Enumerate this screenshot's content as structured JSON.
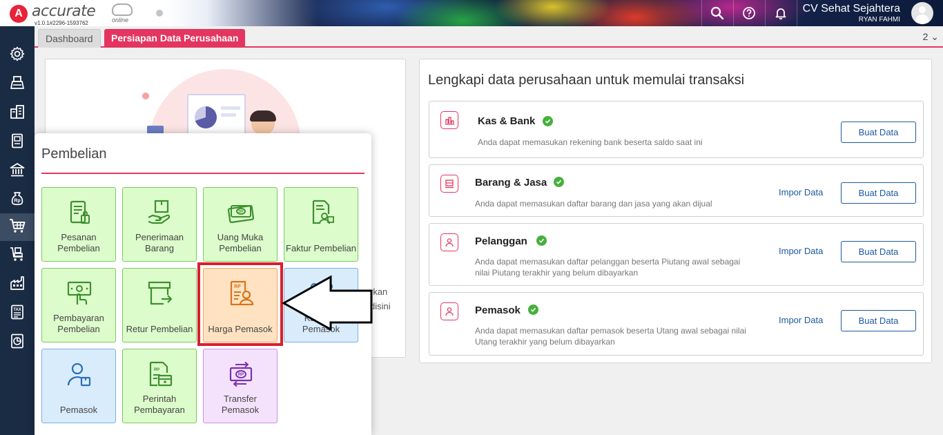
{
  "app": {
    "logo_text": "accurate",
    "logo_suffix": "online",
    "version": "v1.0.1#2296-1593762",
    "company_name": "CV Sehat Sejahtera",
    "user_name": "RYAN FAHMI"
  },
  "header_icons": [
    "search-icon",
    "help-icon",
    "bell-icon"
  ],
  "sidebar": {
    "items": [
      {
        "icon": "gear-icon"
      },
      {
        "icon": "printer-icon"
      },
      {
        "icon": "building-icon"
      },
      {
        "icon": "ledger-icon"
      },
      {
        "icon": "bank-icon"
      },
      {
        "icon": "cash-bag-icon"
      },
      {
        "icon": "shopping-cart-icon",
        "active": true
      },
      {
        "icon": "shipping-cart-icon"
      },
      {
        "icon": "factory-icon"
      },
      {
        "icon": "tax-icon"
      },
      {
        "icon": "report-icon"
      }
    ]
  },
  "tabs": {
    "items": [
      {
        "label": "Dashboard"
      },
      {
        "label": "Persiapan Data Perusahaan",
        "active": true
      }
    ],
    "count": "2",
    "chevron": "⌄"
  },
  "left_panel": {
    "text_line1": "rkan",
    "text_line2": "disini"
  },
  "right_panel": {
    "title": "Lengkapi data perusahaan untuk memulai transaksi",
    "cards": [
      {
        "title": "Kas & Bank",
        "desc": "Anda dapat memasukan rekening bank beserta saldo saat ini",
        "import": "",
        "create": "Buat Data"
      },
      {
        "title": "Barang & Jasa",
        "desc": "Anda dapat memasukan daftar barang dan jasa yang akan dijual",
        "import": "Impor Data",
        "create": "Buat Data"
      },
      {
        "title": "Pelanggan",
        "desc": "Anda dapat memasukan daftar pelanggan beserta Piutang awal sebagai nilai Piutang terakhir yang belum dibayarkan",
        "import": "Impor Data",
        "create": "Buat Data"
      },
      {
        "title": "Pemasok",
        "desc": "Anda dapat memasukan daftar pemasok beserta Utang awal sebagai nilai Utang terakhir yang belum dibayarkan",
        "import": "Impor Data",
        "create": "Buat Data"
      }
    ]
  },
  "menu": {
    "title": "Pembelian",
    "tiles": [
      {
        "label": "Pesanan Pembelian",
        "color": "green",
        "icon": "purchase-order-icon"
      },
      {
        "label": "Penerimaan Barang",
        "color": "green",
        "icon": "goods-receipt-icon"
      },
      {
        "label": "Uang Muka Pembelian",
        "color": "green",
        "icon": "down-payment-icon"
      },
      {
        "label": "Faktur Pembelian",
        "color": "green",
        "icon": "purchase-invoice-icon"
      },
      {
        "label": "Pembayaran Pembelian",
        "color": "green",
        "icon": "purchase-payment-icon"
      },
      {
        "label": "Retur Pembelian",
        "color": "green",
        "icon": "purchase-return-icon"
      },
      {
        "label": "Harga Pemasok",
        "color": "orange",
        "icon": "supplier-price-icon",
        "highlighted": true
      },
      {
        "label": "Kategori Pemasok",
        "color": "blue",
        "icon": "supplier-category-icon"
      },
      {
        "label": "Pemasok",
        "color": "blue",
        "icon": "supplier-icon"
      },
      {
        "label": "Perintah Pembayaran",
        "color": "green",
        "icon": "payment-order-icon"
      },
      {
        "label": "Transfer Pemasok",
        "color": "purple",
        "icon": "supplier-transfer-icon"
      }
    ]
  },
  "colors": {
    "accent": "#e3355f",
    "sidebar": "#1a2b44",
    "link": "#1a5aa0",
    "check": "#46b03c",
    "highlight": "#d9202a"
  }
}
